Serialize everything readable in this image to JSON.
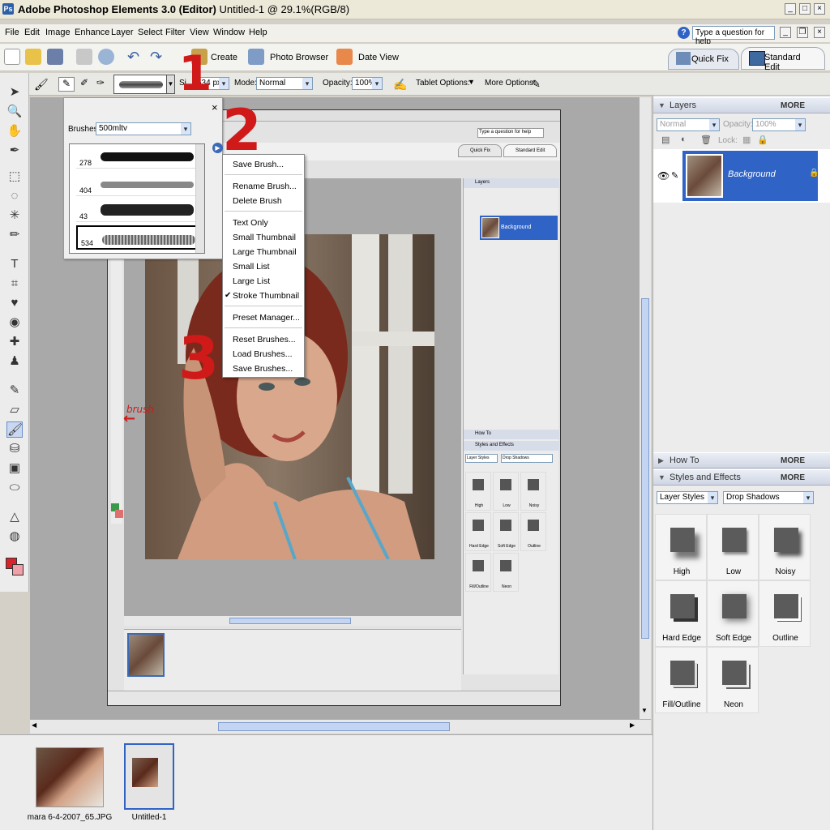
{
  "app": {
    "title_bold": "Adobe Photoshop Elements 3.0 (Editor)",
    "title_rest": "Untitled-1 @ 29.1%(RGB/8)"
  },
  "menu": [
    "File",
    "Edit",
    "Image",
    "Enhance",
    "Layer",
    "Select",
    "Filter",
    "View",
    "Window",
    "Help"
  ],
  "help_placeholder": "Type a question for help",
  "shortcuts": {
    "create": "Create",
    "photo_browser": "Photo Browser",
    "date_view": "Date View",
    "quick_fix": "Quick Fix",
    "standard_edit": "Standard Edit"
  },
  "options": {
    "size_label": "Si",
    "size_value": "534 px",
    "mode_label": "Mode:",
    "mode_value": "Normal",
    "opacity_label": "Opacity:",
    "opacity_value": "100%",
    "tablet": "Tablet Options:",
    "more": "More Options:"
  },
  "brushes": {
    "label": "Brushes:",
    "set": "500mltv",
    "items": [
      {
        "num": "278"
      },
      {
        "num": "404"
      },
      {
        "num": "43"
      },
      {
        "num": "534"
      }
    ]
  },
  "flyout": {
    "items": [
      "Save Brush...",
      "Rename Brush...",
      "Delete Brush",
      "Text Only",
      "Small Thumbnail",
      "Large Thumbnail",
      "Small List",
      "Large List",
      "Stroke Thumbnail",
      "Preset Manager...",
      "Reset Brushes...",
      "Load Brushes...",
      "Save Brushes..."
    ],
    "checked": "Stroke Thumbnail"
  },
  "annotations": {
    "one": "1",
    "two": "2",
    "three": "3",
    "brush": "brush"
  },
  "layers": {
    "title": "Layers",
    "more": "MORE",
    "mode": "Normal",
    "opacity_label": "Opacity:",
    "opacity": "100%",
    "lock": "Lock:",
    "layer_name": "Background"
  },
  "howto": {
    "title": "How To",
    "more": "MORE"
  },
  "styles": {
    "title": "Styles and Effects",
    "more": "MORE",
    "category": "Layer Styles",
    "type": "Drop Shadows",
    "effects": [
      "High",
      "Low",
      "Noisy",
      "Hard Edge",
      "Soft Edge",
      "Outline",
      "Fill/Outline",
      "Neon"
    ]
  },
  "photobin": {
    "items": [
      "mara 6-4-2007_65.JPG",
      "Untitled-1"
    ]
  },
  "inner": {
    "help": "Type a question for help",
    "quick_fix": "Quick Fix",
    "standard_edit": "Standard Edit",
    "layers": "Layers",
    "background": "Background",
    "howto": "How To",
    "styles": "Styles and Effects",
    "category": "Layer Styles",
    "type": "Drop Shadows",
    "effects": [
      "High",
      "Low",
      "Noisy",
      "Hard Edge",
      "Soft Edge",
      "Outline",
      "Fill/Outline",
      "Neon"
    ]
  },
  "colors": {
    "accent": "#2f63c6",
    "annotation": "#d01a1a",
    "fg_swatch": "#d9232b"
  }
}
